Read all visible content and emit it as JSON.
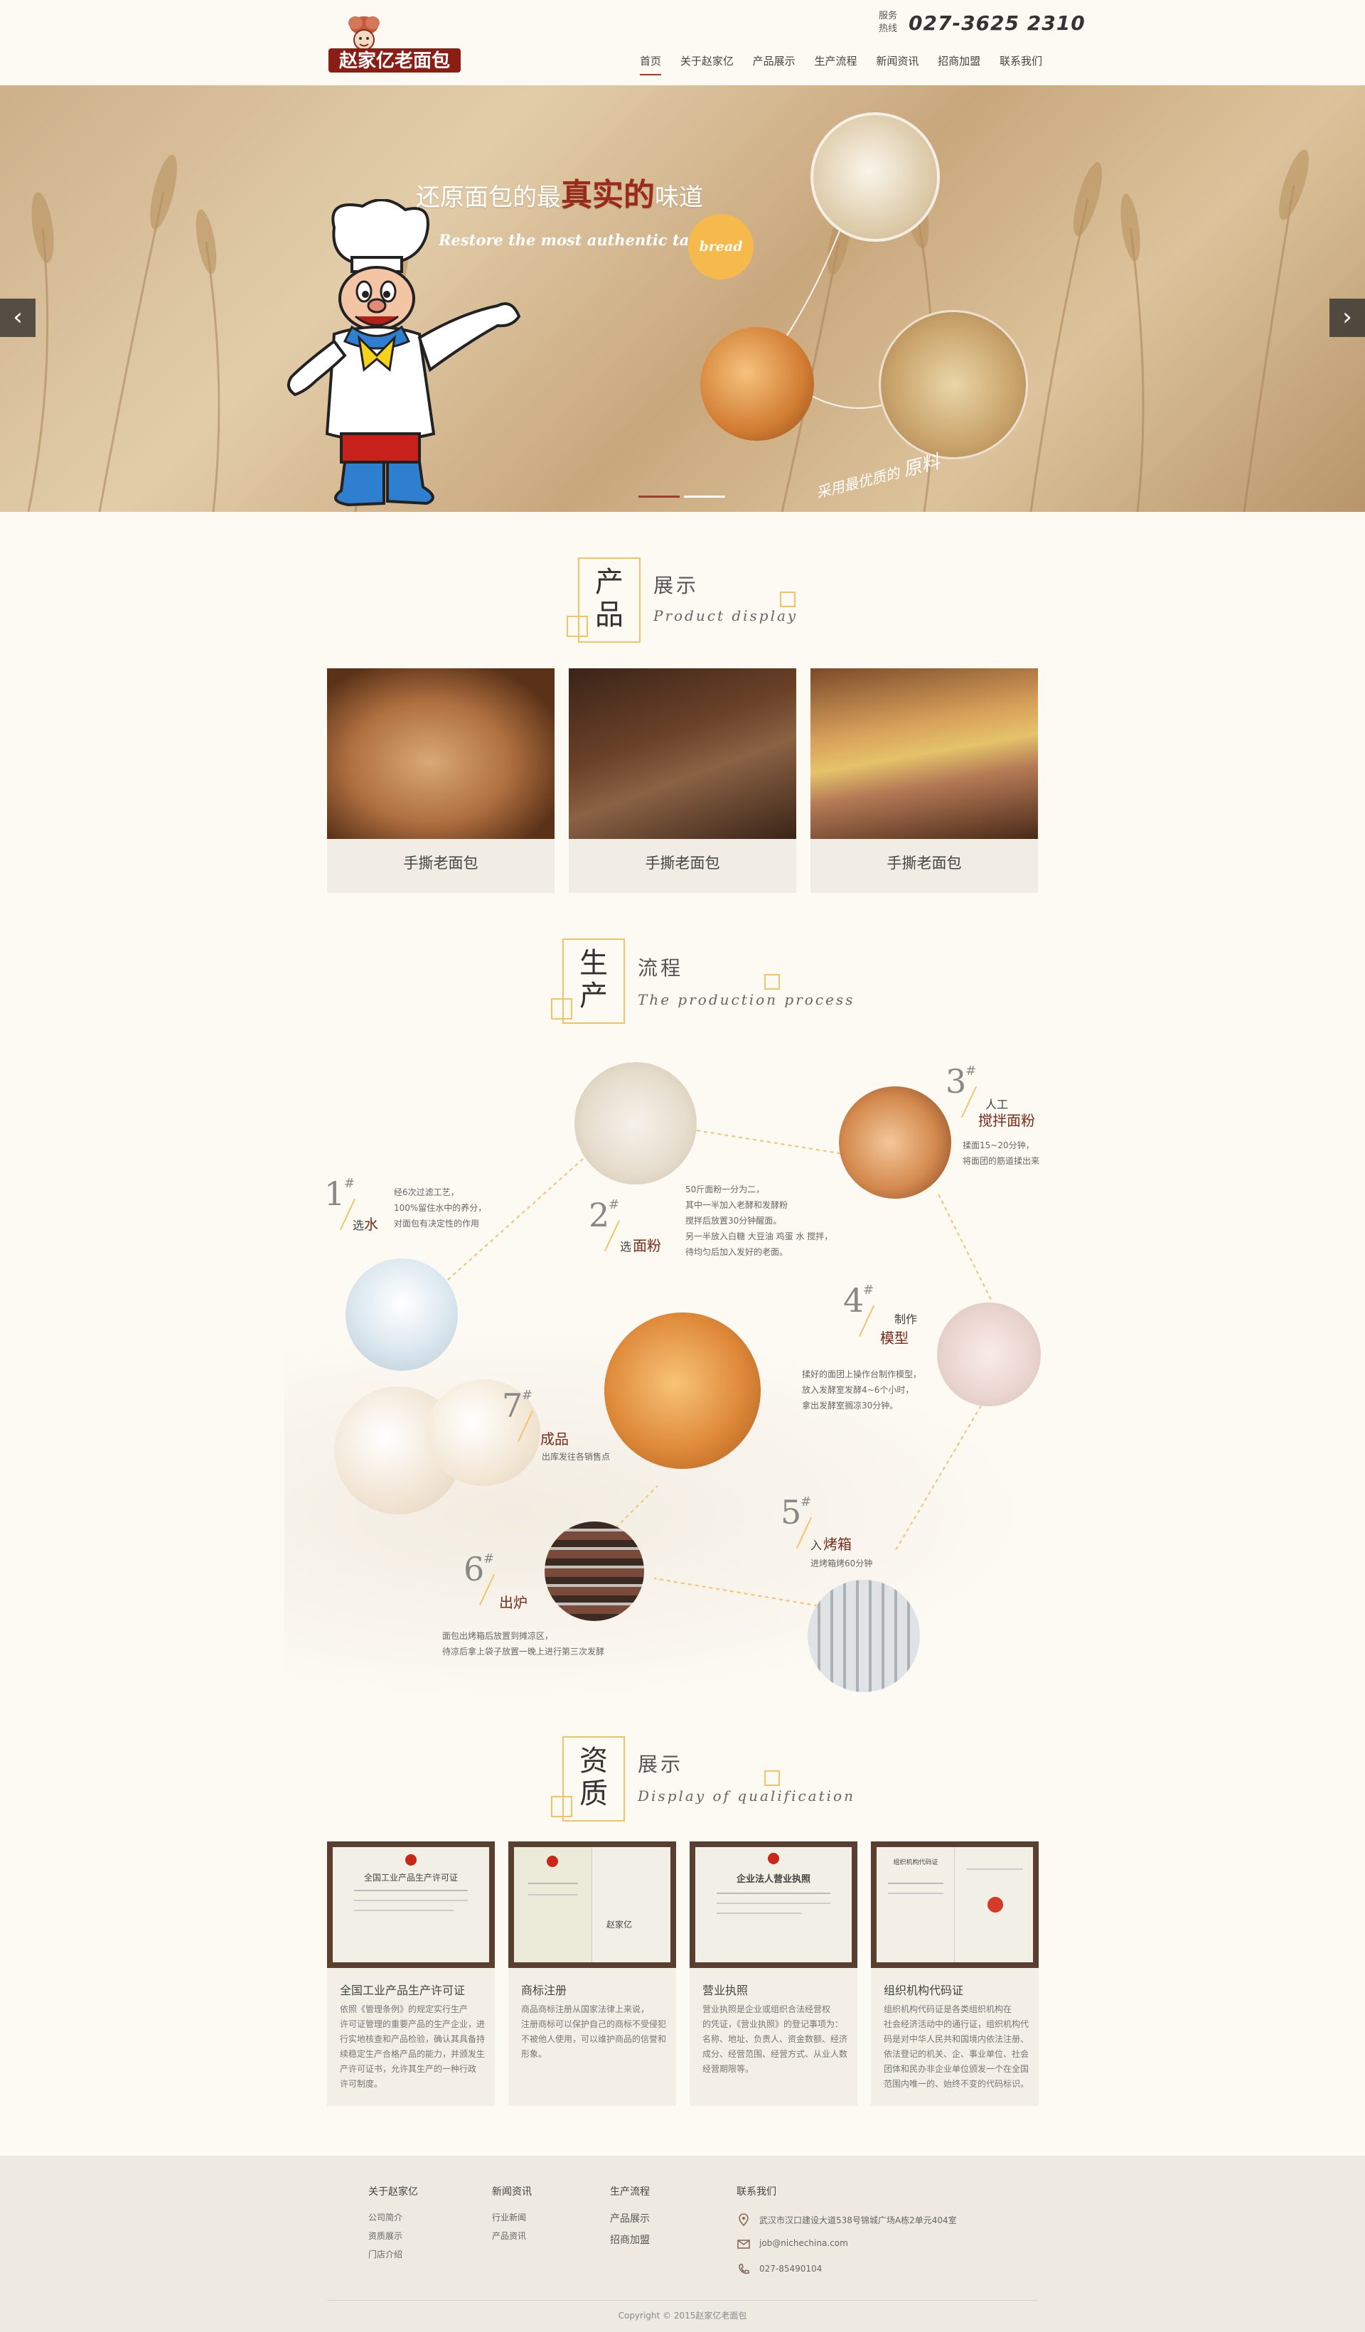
{
  "header": {
    "logo_text": "赵家亿老面包",
    "hotline_label": "服务热线",
    "hotline_number": "027-3625  2310",
    "nav": [
      "首页",
      "关于赵家亿",
      "产品展示",
      "生产流程",
      "新闻资讯",
      "招商加盟",
      "联系我们"
    ]
  },
  "banner": {
    "title_pre": "还原面包的最",
    "title_em": "真实的",
    "title_post": "味道",
    "subtitle": "Restore the most authentic taste of",
    "badge": "bread",
    "note_a": "采用最优质的",
    "note_b": "原料",
    "prev": "‹",
    "next": "›"
  },
  "products": {
    "head_cn1": "产品",
    "head_cn2": "展示",
    "head_en": "Product display",
    "items": [
      {
        "caption": "手撕老面包"
      },
      {
        "caption": "手撕老面包"
      },
      {
        "caption": "手撕老面包"
      }
    ]
  },
  "process": {
    "head_cn1": "生产",
    "head_cn2": "流程",
    "head_en": "The production process",
    "steps": [
      {
        "num": "1",
        "hash": "#",
        "t1": "选",
        "t2": "水",
        "desc": [
          "经6次过滤工艺，",
          "100%留住水中的养分，",
          "对面包有决定性的作用"
        ]
      },
      {
        "num": "2",
        "hash": "#",
        "t1": "选",
        "t2": "面粉",
        "desc": [
          "50斤面粉一分为二，",
          "其中一半加入老酵和发酵粉",
          "搅拌后放置30分钟醒面。",
          "另一半放入白糖 大豆油 鸡蛋 水 搅拌，",
          "待均匀后加入发好的老面。"
        ]
      },
      {
        "num": "3",
        "hash": "#",
        "t1": "人工",
        "t2": "搅拌面粉",
        "desc": [
          "揉面15~20分钟，",
          "将面团的筋道揉出来"
        ]
      },
      {
        "num": "4",
        "hash": "#",
        "t1": "制作",
        "t2": "模型",
        "desc": [
          "揉好的面团上操作台制作模型，",
          "放入发酵室发酵4~6个小时，",
          "拿出发酵室搁凉30分钟。"
        ]
      },
      {
        "num": "5",
        "hash": "#",
        "t1": "入",
        "t2": "烤箱",
        "desc": [
          "进烤箱烤60分钟"
        ]
      },
      {
        "num": "6",
        "hash": "#",
        "t1": "",
        "t2": "出炉",
        "desc": [
          "面包出烤箱后放置到摊凉区，",
          "待凉后拿上袋子放置一晚上进行第三次发酵"
        ]
      },
      {
        "num": "7",
        "hash": "#",
        "t1": "",
        "t2": "成品",
        "desc": [
          "出库发往各销售点"
        ]
      }
    ]
  },
  "qualification": {
    "head_cn1": "资质",
    "head_cn2": "展示",
    "head_en": "Display of qualification",
    "items": [
      {
        "cert_title": "全国工业产品生产许可证",
        "title": "全国工业产品生产许可证",
        "text": [
          "依照《管理条例》的规定实行生产",
          "许可证管理的重要产品的生产企业，进",
          "行实地核查和产品检验，确认其具备持",
          "续稳定生产合格产品的能力，并颁发生",
          "产许可证书，允许其生产的一种行政",
          "许可制度。"
        ]
      },
      {
        "cert_title": "赵家亿",
        "title": "商标注册",
        "text": [
          "商品商标注册从国家法律上来说，",
          "注册商标可以保护自己的商标不受侵犯，",
          "不被他人使用，可以维护商品的信誉和",
          "形象。"
        ]
      },
      {
        "cert_title": "企业法人营业执照",
        "title": "营业执照",
        "text": [
          "营业执照是企业或组织合法经营权",
          "的凭证，《营业执照》的登记事项为：",
          "名称、地址、负责人、资金数额、经济",
          "成分、经营范围、经营方式、从业人数、",
          "经营期限等。"
        ]
      },
      {
        "cert_title": "组织机构代码证",
        "title": "组织机构代码证",
        "text": [
          "组织机构代码证是各类组织机构在",
          "社会经济活动中的通行证，组织机构代",
          "码是对中华人民共和国境内依法注册、",
          "依法登记的机关、企、事业单位、社会",
          "团体和民办非企业单位颁发一个在全国",
          "范围内唯一的、始终不变的代码标识。"
        ]
      }
    ]
  },
  "footer": {
    "col1": {
      "head": "关于赵家亿",
      "items": [
        "公司简介",
        "资质展示",
        "门店介绍"
      ]
    },
    "col2": {
      "head": "新闻资讯",
      "items": [
        "行业新闻",
        "产品资讯"
      ]
    },
    "col3": {
      "head": "生产流程",
      "items": [
        "产品展示",
        "招商加盟"
      ]
    },
    "contact": {
      "head": "联系我们",
      "address": "武汉市汉口建设大道538号锦城广场A栋2单元404室",
      "email": "job@nichechina.com",
      "phone": "027-85490104"
    },
    "copyright": "Copyright © 2015赵家亿老面包"
  },
  "colors": {
    "accent": "#a33a2a",
    "gold": "#f2c46a",
    "badge": "#f6b94c",
    "bg": "#fdfaf4",
    "footer_bg": "#eeeae2"
  }
}
